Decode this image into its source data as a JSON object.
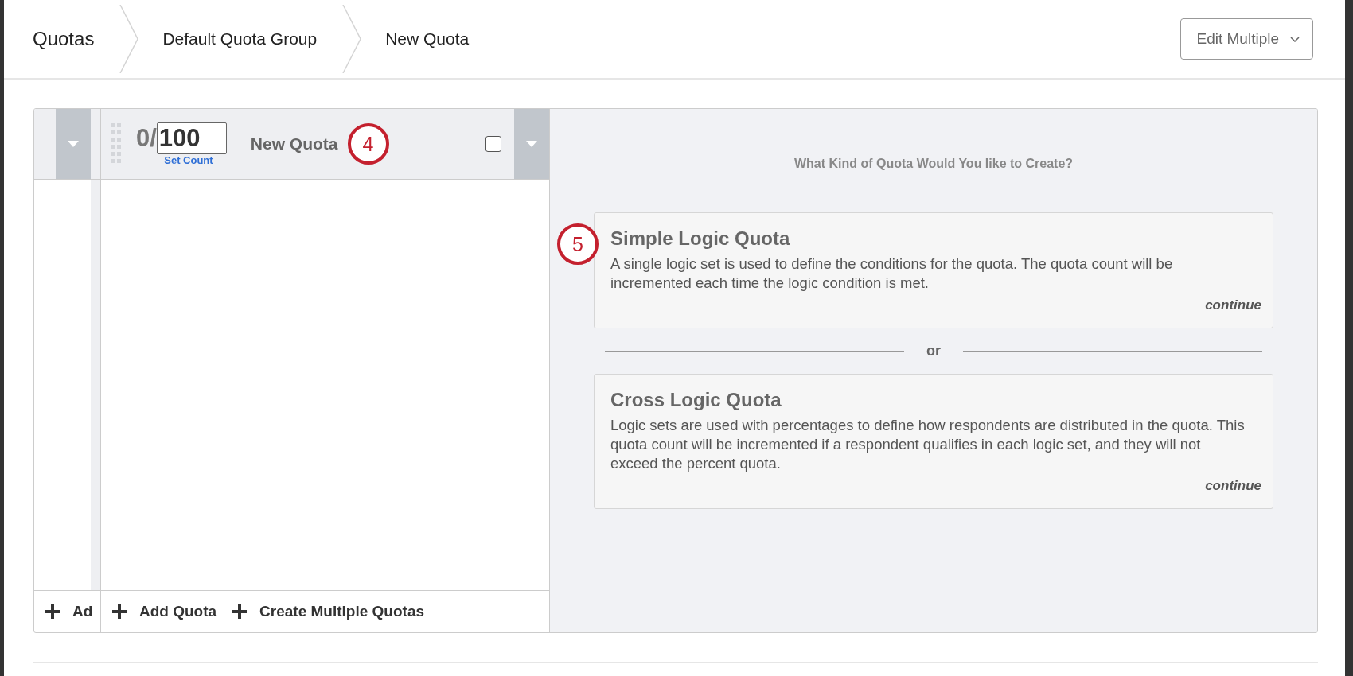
{
  "breadcrumbs": [
    {
      "label": "Quotas"
    },
    {
      "label": "Default Quota Group"
    },
    {
      "label": "New Quota"
    }
  ],
  "edit_button": {
    "label": "Edit Multiple"
  },
  "quota": {
    "count": "0/",
    "target": "100",
    "set_count_link": "Set Count",
    "name": "New Quota",
    "checked": false,
    "callout": "4"
  },
  "prompt": "What Kind of Quota Would You like to Create?",
  "options": [
    {
      "title": "Simple Logic Quota",
      "description": "A single logic set is used to define the conditions for the quota. The quota count will be incremented each time the logic condition is met.",
      "action": "continue",
      "callout": "5"
    },
    {
      "title": "Cross Logic Quota",
      "description": "Logic sets are used with percentages to define how respondents are distributed in the quota. This quota count will be incremented if a respondent qualifies in each logic set, and they will not exceed the percent quota.",
      "action": "continue"
    }
  ],
  "separator": "or",
  "left_footer": {
    "label": "Ad"
  },
  "footer_actions": [
    "Add Quota",
    "Create Multiple Quotas"
  ]
}
